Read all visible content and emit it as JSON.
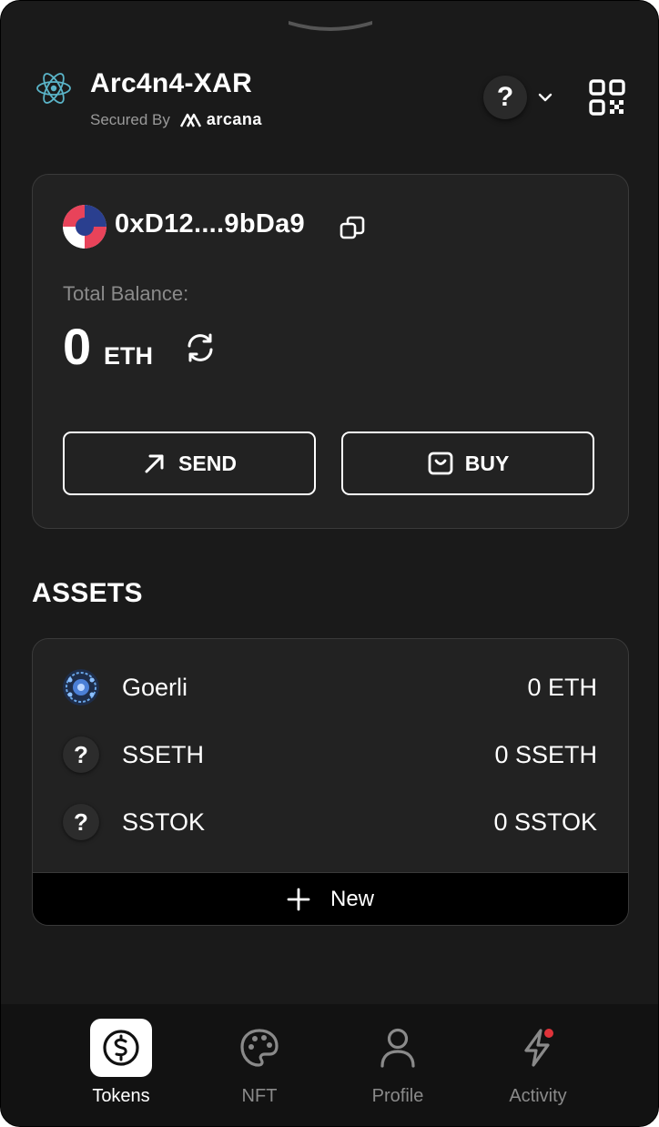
{
  "header": {
    "app_name": "Arc4n4-XAR",
    "secured_by": "Secured By",
    "brand": "arcana",
    "network_symbol": "?"
  },
  "wallet": {
    "address": "0xD12....9bDa9",
    "balance_label": "Total Balance:",
    "balance_value": "0",
    "balance_unit": "ETH",
    "send_label": "SEND",
    "buy_label": "BUY"
  },
  "assets": {
    "title": "ASSETS",
    "items": [
      {
        "name": "Goerli",
        "amount": "0 ETH",
        "icon": "goerli-token-icon"
      },
      {
        "name": "SSETH",
        "amount": "0 SSETH",
        "icon": "unknown-token-icon",
        "symbol": "?"
      },
      {
        "name": "SSTOK",
        "amount": "0 SSTOK",
        "icon": "unknown-token-icon",
        "symbol": "?"
      }
    ],
    "new_label": "New"
  },
  "nav": {
    "items": [
      {
        "label": "Tokens",
        "icon": "dollar-coin-icon",
        "active": true
      },
      {
        "label": "NFT",
        "icon": "palette-icon",
        "active": false
      },
      {
        "label": "Profile",
        "icon": "user-icon",
        "active": false
      },
      {
        "label": "Activity",
        "icon": "lightning-icon",
        "active": false
      }
    ]
  },
  "colors": {
    "background": "#1a1a1a",
    "card": "#222222",
    "text": "#ffffff",
    "muted": "#8a8a8a",
    "notification_dot": "#e0333a"
  }
}
